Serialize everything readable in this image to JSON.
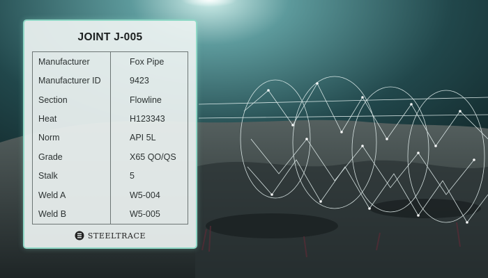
{
  "card": {
    "title": "JOINT J-005",
    "rows": [
      {
        "label": "Manufacturer",
        "value": "Fox Pipe"
      },
      {
        "label": "Manufacturer ID",
        "value": "9423"
      },
      {
        "label": "Section",
        "value": "Flowline"
      },
      {
        "label": "Heat",
        "value": "H123343"
      },
      {
        "label": "Norm",
        "value": "API 5L"
      },
      {
        "label": "Grade",
        "value": "X65 QO/QS"
      },
      {
        "label": "Stalk",
        "value": "5"
      },
      {
        "label": "Weld A",
        "value": "W5-004"
      },
      {
        "label": "Weld B",
        "value": "W5-005"
      }
    ],
    "brand": {
      "name": "STEELTRACE",
      "logo_icon": "steeltrace-logo-icon"
    }
  },
  "theme": {
    "accent": "#8fd8c6",
    "card_background": "#ecf2f1",
    "water_top": "#3b6f73",
    "seabed": "#3a4143"
  }
}
